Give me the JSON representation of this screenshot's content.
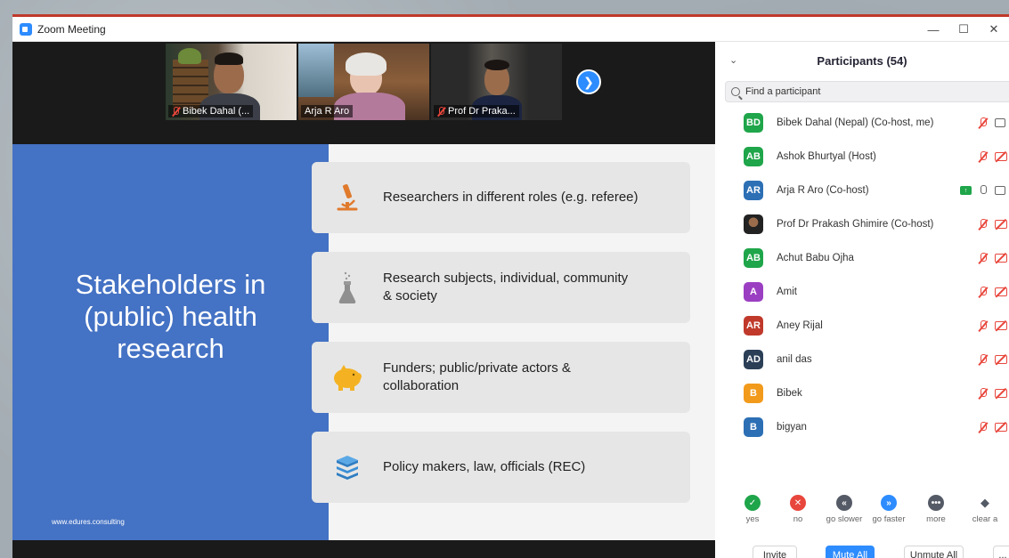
{
  "window": {
    "title": "Zoom Meeting",
    "controls": [
      "—",
      "☐",
      "✕"
    ]
  },
  "thumbnails": [
    {
      "label": "Bibek Dahal (...",
      "muted": true,
      "active": false
    },
    {
      "label": "Arja R Aro",
      "muted": false,
      "active": true
    },
    {
      "label": "Prof Dr Praka...",
      "muted": true,
      "active": false
    }
  ],
  "slide": {
    "title_line1": "Stakeholders in",
    "title_line2": "(public) health",
    "title_line3": "research",
    "url": "www.edures.consulting",
    "cards": [
      {
        "icon": "microscope-icon",
        "line1": "Researchers in different roles (e.g. referee)",
        "line2": ""
      },
      {
        "icon": "flask-icon",
        "line1": "Research subjects, individual, community",
        "line2": "& society"
      },
      {
        "icon": "piggy-bank-icon",
        "line1": "Funders; public/private actors &",
        "line2": "collaboration"
      },
      {
        "icon": "books-icon",
        "line1": "Policy makers, law, officials (REC)",
        "line2": ""
      }
    ]
  },
  "participants": {
    "title": "Participants (54)",
    "search_placeholder": "Find a participant",
    "list": [
      {
        "initials": "BD",
        "color": "#1fa54a",
        "name": "Bibek Dahal (Nepal) (Co-host, me)",
        "mic": "red",
        "cam": "gray"
      },
      {
        "initials": "AB",
        "color": "#1fa54a",
        "name": "Ashok Bhurtyal (Host)",
        "mic": "red",
        "cam": "red"
      },
      {
        "initials": "AR",
        "color": "#2c6fb5",
        "name": "Arja R Aro (Co-host)",
        "mic": "gray",
        "cam": "gray",
        "sharing": true
      },
      {
        "initials": "",
        "color": "#4a4a4a",
        "name": "Prof Dr Prakash Ghimire (Co-host)",
        "mic": "red",
        "cam": "red",
        "photo": true
      },
      {
        "initials": "AB",
        "color": "#1fa54a",
        "name": "Achut Babu Ojha",
        "mic": "red",
        "cam": "red"
      },
      {
        "initials": "A",
        "color": "#9b3fc2",
        "name": "Amit",
        "mic": "red",
        "cam": "red"
      },
      {
        "initials": "AR",
        "color": "#c0392b",
        "name": "Aney Rijal",
        "mic": "red",
        "cam": "red"
      },
      {
        "initials": "AD",
        "color": "#2b3f57",
        "name": "anil das",
        "mic": "red",
        "cam": "red"
      },
      {
        "initials": "B",
        "color": "#f29a1b",
        "name": "Bibek",
        "mic": "red",
        "cam": "red"
      },
      {
        "initials": "B",
        "color": "#2c6fb5",
        "name": "bigyan",
        "mic": "red",
        "cam": "red"
      }
    ],
    "reactions": [
      {
        "label": "yes",
        "symbol": "✓",
        "color": "#1fa54a"
      },
      {
        "label": "no",
        "symbol": "✕",
        "color": "#e8463c"
      },
      {
        "label": "go slower",
        "symbol": "«",
        "color": "#555b66"
      },
      {
        "label": "go faster",
        "symbol": "»",
        "color": "#2d8cff"
      },
      {
        "label": "more",
        "symbol": "•••",
        "color": "#555b66"
      },
      {
        "label": "clear a",
        "symbol": "◆",
        "color": "#555b66"
      }
    ],
    "buttons": {
      "invite": "Invite",
      "mute_all": "Mute All",
      "unmute_all": "Unmute All",
      "more": "..."
    }
  }
}
